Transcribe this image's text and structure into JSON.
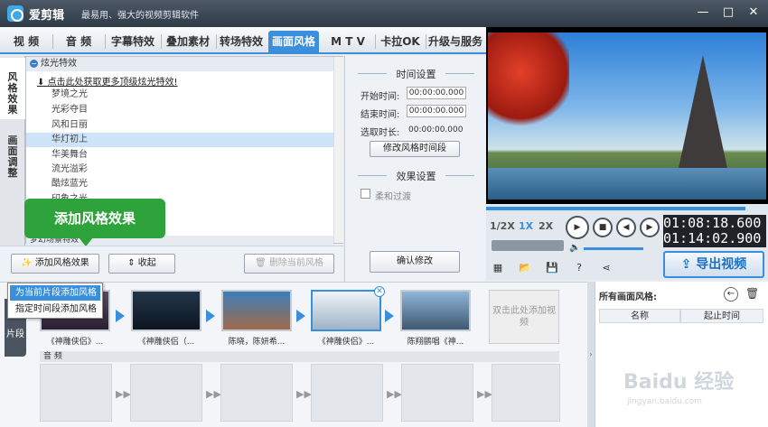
{
  "app": {
    "name": "爱剪辑",
    "slogan": "最易用、强大的视频剪辑软件"
  },
  "window": {
    "minimize": "—",
    "maximize": "□",
    "close": "✕"
  },
  "tabs": [
    "视 频",
    "音 频",
    "字幕特效",
    "叠加素材",
    "转场特效",
    "画面风格",
    "M T V",
    "卡拉OK",
    "升级与服务"
  ],
  "side_tabs": [
    "风格效果",
    "画面调整"
  ],
  "effects": {
    "group": "炫光特效",
    "promo": "点击此处获取更多顶级炫光特效!",
    "items": [
      "梦境之光",
      "光彩夺目",
      "风和日丽",
      "华灯初上",
      "华美舞台",
      "流光溢彩",
      "酷炫蓝光",
      "印象之光"
    ],
    "selected": "华灯初上",
    "group2": "梦幻场景特效"
  },
  "time_settings": {
    "title": "时间设置",
    "start_label": "开始时间:",
    "start_value": "00:00:00.000",
    "end_label": "结束时间:",
    "end_value": "00:00:00.000",
    "duration_label": "选取时长:",
    "duration_value": "00:00:00.000",
    "modify_btn": "修改风格时间段"
  },
  "effect_settings": {
    "title": "效果设置",
    "soft_transition": "柔和过渡"
  },
  "buttons": {
    "add_style": "添加风格效果",
    "collapse": "收起",
    "delete_style": "删除当前风格",
    "confirm": "确认修改"
  },
  "callout": "添加风格效果",
  "dropdown": [
    "为当前片段添加风格",
    "指定时间段添加风格"
  ],
  "player": {
    "speeds": [
      "1/2X",
      "1X",
      "2X"
    ],
    "current_time": "01:08:18.600",
    "total_time": "01:14:02.900",
    "export": "导出视频"
  },
  "timeline": {
    "side_label": "片段",
    "clips": [
      "《神雕侠侣》...",
      "《神雕侠侣（...",
      "陈晓，陈妍希...",
      "《神雕侠侣》...",
      "陈翔鹏唱《神..."
    ],
    "add_clip": "双击此处添加视频",
    "audio_label": "音 频"
  },
  "styles_panel": {
    "title": "所有画面风格:",
    "col_name": "名称",
    "col_time": "起止时间"
  },
  "watermark": {
    "text": "Baidu 经验",
    "sub": "jingyan.baidu.com"
  }
}
